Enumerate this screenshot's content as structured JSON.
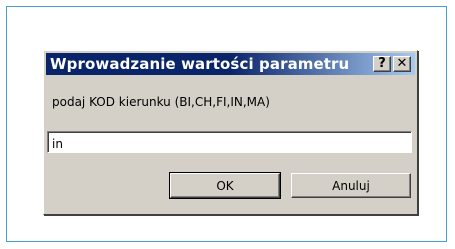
{
  "dialog": {
    "title": "Wprowadzanie wartości parametru",
    "help_label": "?",
    "close_label": "✕",
    "prompt": "podaj KOD kierunku (BI,CH,FI,IN,MA)",
    "input_value": "in",
    "ok_label": "OK",
    "cancel_label": "Anuluj"
  },
  "colors": {
    "titlebar_start": "#0a246a",
    "titlebar_end": "#a6caf0",
    "dialog_face": "#d4d0c8",
    "frame_border": "#4a9fd0"
  }
}
